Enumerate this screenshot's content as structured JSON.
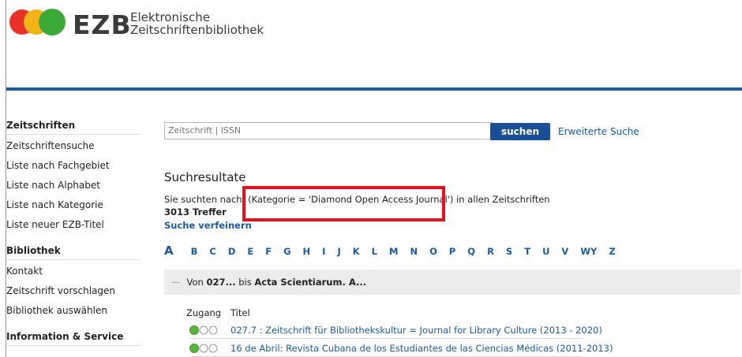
{
  "header": {
    "logo_text": "EZB",
    "subtitle_line1": "Elektronische",
    "subtitle_line2": "Zeitschriftenbibliothek"
  },
  "sidebar": {
    "sections": [
      {
        "heading": "Zeitschriften",
        "items": [
          "Zeitschriftensuche",
          "Liste nach Fachgebiet",
          "Liste nach Alphabet",
          "Liste nach Kategorie",
          "Liste neuer EZB-Titel"
        ]
      },
      {
        "heading": "Bibliothek",
        "items": [
          "Kontakt",
          "Zeitschrift vorschlagen",
          "Bibliothek auswählen"
        ]
      },
      {
        "heading": "Information & Service",
        "items": []
      }
    ]
  },
  "search": {
    "placeholder": "Zeitschrift | ISSN",
    "button_label": "suchen",
    "advanced_link": "Erweiterte Suche"
  },
  "results": {
    "title": "Suchresultate",
    "query_prefix": "Sie suchten nach:",
    "query_term": "(Kategorie = 'Diamond Open Access Journal')",
    "query_suffix": "in allen Zeitschriften",
    "hits": "3013 Treffer",
    "refine_link": "Suche verfeinern"
  },
  "alphabet": [
    "A",
    "B",
    "C",
    "D",
    "E",
    "F",
    "G",
    "H",
    "I",
    "J",
    "K",
    "L",
    "M",
    "N",
    "O",
    "P",
    "Q",
    "R",
    "S",
    "T",
    "U",
    "V",
    "WY",
    "Z"
  ],
  "range": {
    "from_label": "Von",
    "from_value": "027...",
    "to_label": "bis",
    "to_value": "Acta Scientiarum. A..."
  },
  "list": {
    "col_access": "Zugang",
    "col_title": "Titel",
    "rows": [
      {
        "title": "027.7 : Zeitschrift für Bibliothekskultur = Journal for Library Culture (2013 - 2020)"
      },
      {
        "title": "16 de Abril: Revista Cubana de los Estudiantes de las Ciencias Médicas (2011-2013)"
      }
    ]
  },
  "colors": {
    "accent_blue": "#1a5ba6",
    "button_blue": "#1a4f97",
    "highlight_red": "#e8101a",
    "access_green": "#5ab33a",
    "logo_red": "#e8322a",
    "logo_yellow": "#f4b418",
    "logo_green": "#3aa935"
  }
}
